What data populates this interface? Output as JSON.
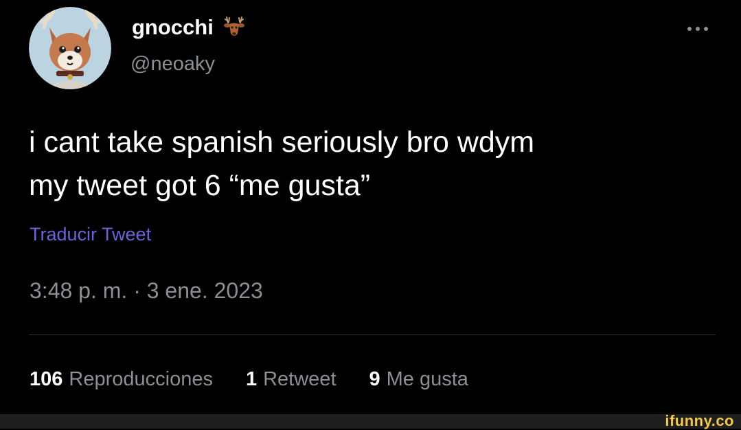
{
  "author": {
    "display_name": "gnocchi",
    "handle": "@neoaky",
    "name_emoji": "deer-icon"
  },
  "tweet": {
    "lines": [
      "i cant take spanish seriously bro wdym",
      "my tweet got 6 “me gusta”"
    ],
    "translate_label": "Traducir Tweet",
    "timestamp": "3:48 p. m. · 3 ene. 2023"
  },
  "stats": {
    "views_count": "106",
    "views_label": "Reproducciones",
    "retweets_count": "1",
    "retweets_label": "Retweet",
    "likes_count": "9",
    "likes_label": "Me gusta"
  },
  "watermark": "ifunny.co",
  "colors": {
    "background": "#000000",
    "text": "#ffffff",
    "secondary": "#8b9096",
    "link": "#6b63d8",
    "watermark": "#f2c94c"
  }
}
